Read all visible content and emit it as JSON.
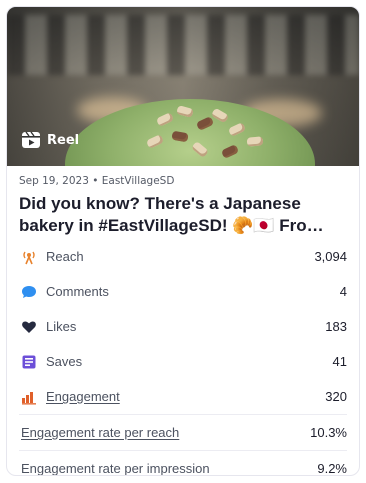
{
  "post": {
    "media_type_label": "Reel",
    "date_account": "Sep 19, 2023 • EastVillageSD",
    "title": "Did you know? There's a Japanese bakery in #EastVillageSD! 🥐🇯🇵 Fro…"
  },
  "metrics": [
    {
      "icon": "reach-icon",
      "label": "Reach",
      "value": "3,094",
      "link": false
    },
    {
      "icon": "comments-icon",
      "label": "Comments",
      "value": "4",
      "link": false
    },
    {
      "icon": "heart-icon",
      "label": "Likes",
      "value": "183",
      "link": false
    },
    {
      "icon": "bookmark-icon",
      "label": "Saves",
      "value": "41",
      "link": false
    },
    {
      "icon": "bar-chart-icon",
      "label": "Engagement",
      "value": "320",
      "link": true
    },
    {
      "icon": "",
      "label": "Engagement rate per reach",
      "value": "10.3%",
      "link": true
    },
    {
      "icon": "",
      "label": "Engagement rate per impression",
      "value": "9.2%",
      "link": true
    }
  ],
  "colors": {
    "reach": "#e8832e",
    "comments": "#2f8ff0",
    "likes": "#252a3f",
    "saves": "#6c4fd8",
    "engagement": "#e0602a",
    "text_dark": "#1c1d2b",
    "text_muted": "#4c5260"
  }
}
